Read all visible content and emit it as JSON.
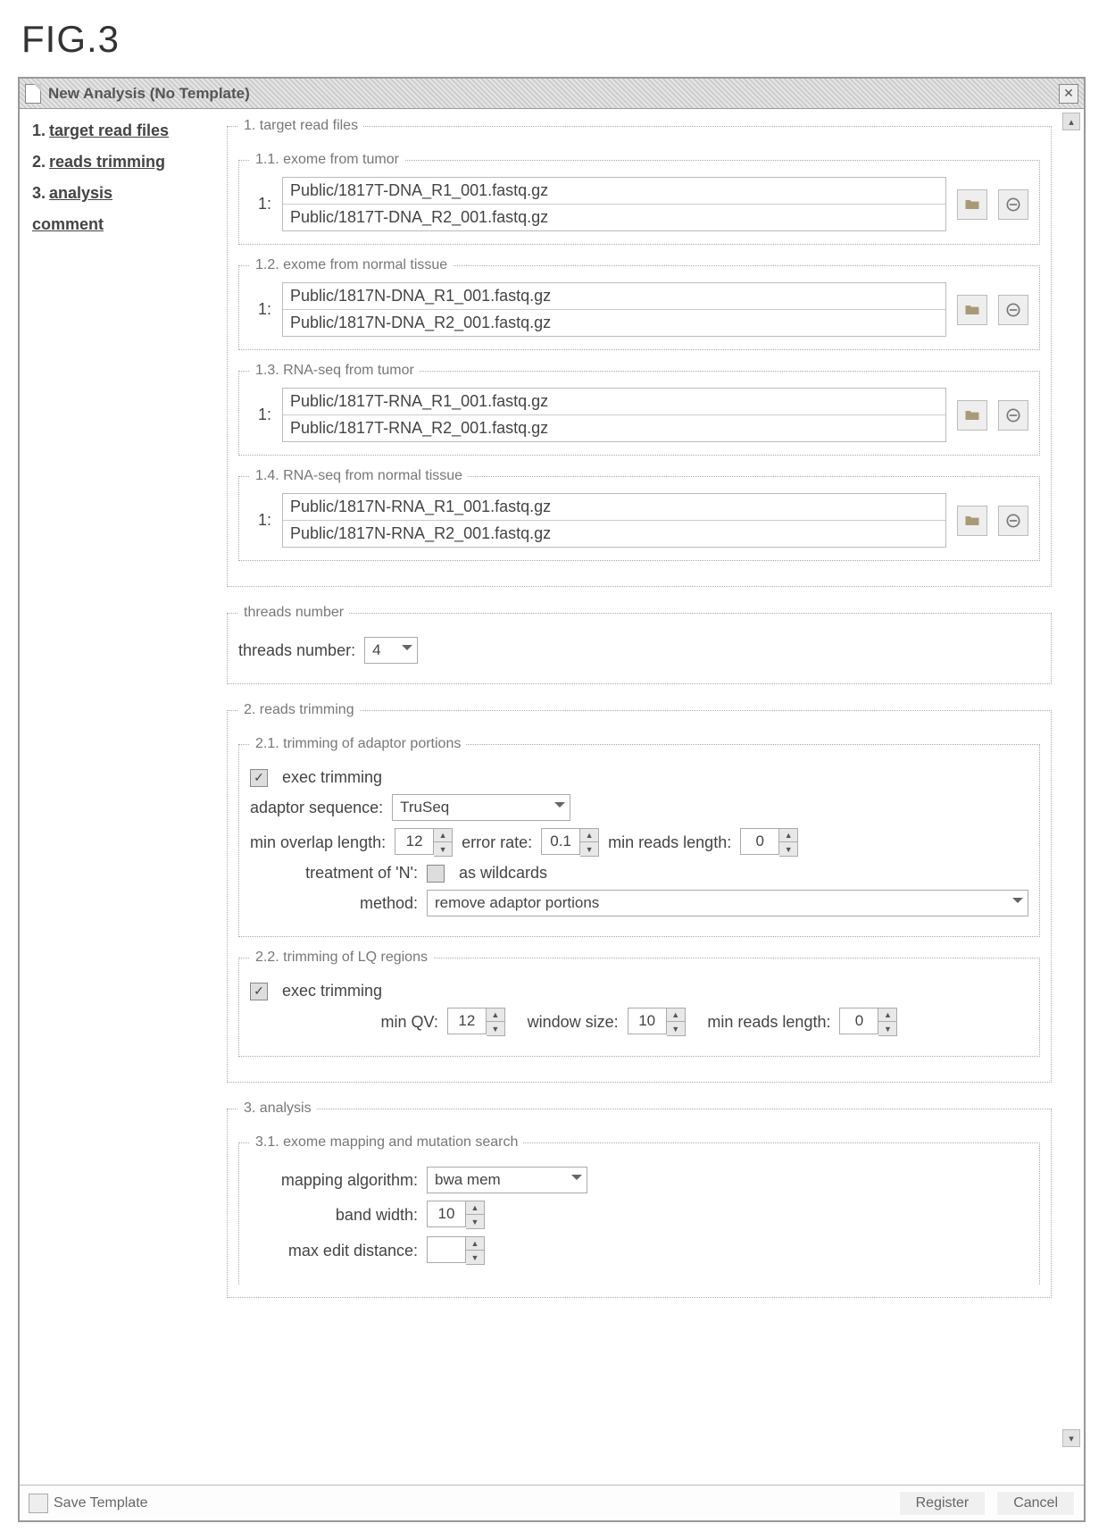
{
  "figure_label": "FIG.3",
  "window_title": "New Analysis (No Template)",
  "sidebar": {
    "items": [
      {
        "num": "1.",
        "label": "target read files"
      },
      {
        "num": "2.",
        "label": "reads trimming"
      },
      {
        "num": "3.",
        "label": "analysis"
      }
    ],
    "comment_label": "comment"
  },
  "section1": {
    "legend": "1. target read files",
    "groups": [
      {
        "legend": "1.1. exome from tumor",
        "idx": "1:",
        "files": [
          "Public/1817T-DNA_R1_001.fastq.gz",
          "Public/1817T-DNA_R2_001.fastq.gz"
        ]
      },
      {
        "legend": "1.2. exome from normal tissue",
        "idx": "1:",
        "files": [
          "Public/1817N-DNA_R1_001.fastq.gz",
          "Public/1817N-DNA_R2_001.fastq.gz"
        ]
      },
      {
        "legend": "1.3. RNA-seq from tumor",
        "idx": "1:",
        "files": [
          "Public/1817T-RNA_R1_001.fastq.gz",
          "Public/1817T-RNA_R2_001.fastq.gz"
        ]
      },
      {
        "legend": "1.4. RNA-seq from normal tissue",
        "idx": "1:",
        "files": [
          "Public/1817N-RNA_R1_001.fastq.gz",
          "Public/1817N-RNA_R2_001.fastq.gz"
        ]
      }
    ]
  },
  "threads": {
    "legend": "threads number",
    "label": "threads number:",
    "value": "4"
  },
  "section2": {
    "legend": "2. reads trimming",
    "g21": {
      "legend": "2.1. trimming of adaptor portions",
      "exec_label": "exec trimming",
      "adaptor_label": "adaptor sequence:",
      "adaptor_value": "TruSeq",
      "min_overlap_label": "min overlap length:",
      "min_overlap_value": "12",
      "error_rate_label": "error rate:",
      "error_rate_value": "0.1",
      "min_reads_label": "min reads length:",
      "min_reads_value": "0",
      "treat_n_label": "treatment of 'N':",
      "wildcards_label": "as wildcards",
      "method_label": "method:",
      "method_value": "remove adaptor portions"
    },
    "g22": {
      "legend": "2.2. trimming of LQ regions",
      "exec_label": "exec trimming",
      "min_qv_label": "min QV:",
      "min_qv_value": "12",
      "window_label": "window size:",
      "window_value": "10",
      "min_reads_label": "min reads length:",
      "min_reads_value": "0"
    }
  },
  "section3": {
    "legend": "3. analysis",
    "g31": {
      "legend": "3.1. exome mapping and mutation search",
      "algo_label": "mapping algorithm:",
      "algo_value": "bwa mem",
      "band_label": "band width:",
      "band_value": "10",
      "dist_label": "max edit distance:",
      "dist_value": ""
    }
  },
  "footer": {
    "save_template": "Save Template",
    "register": "Register",
    "cancel": "Cancel"
  }
}
